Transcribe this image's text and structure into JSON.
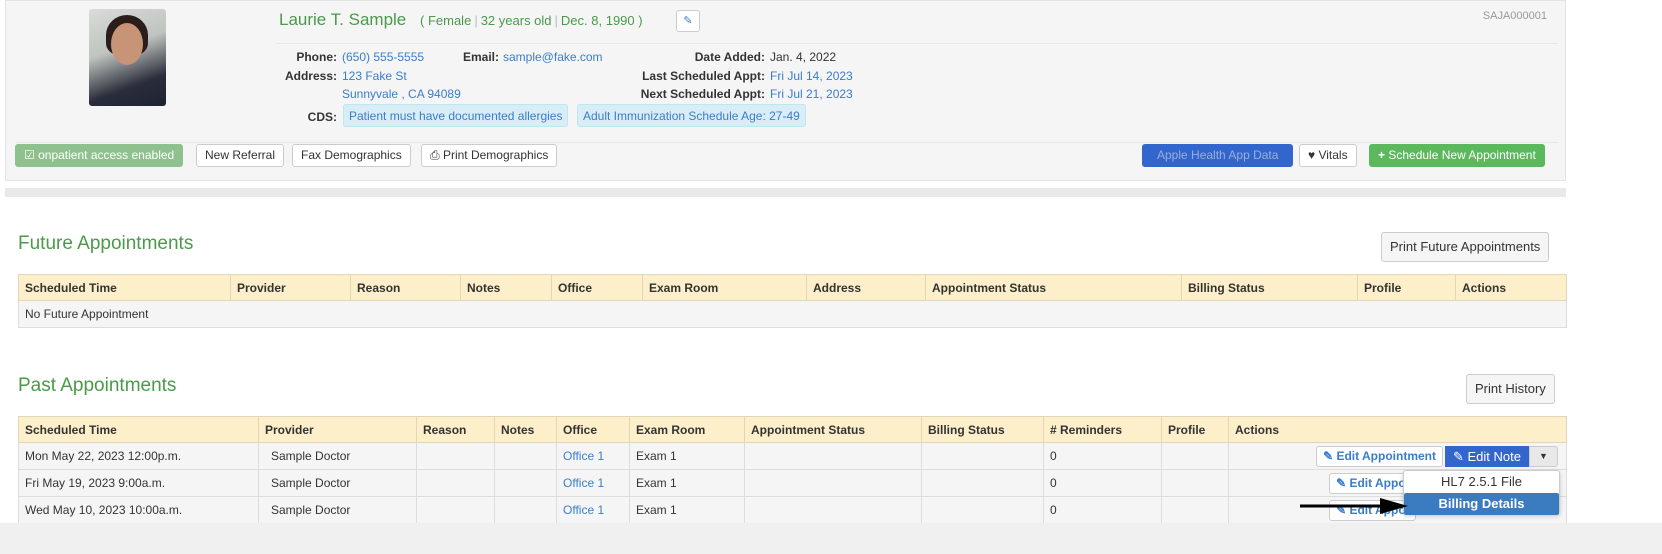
{
  "patient": {
    "name": "Laurie T. Sample",
    "gender": "Female",
    "age": "32 years old",
    "dob": "Dec. 8, 1990",
    "id": "SAJA000001",
    "phone_label": "Phone:",
    "phone": "(650) 555-5555",
    "email_label": "Email:",
    "email": "sample@fake.com",
    "address_label": "Address:",
    "address1": "123 Fake St",
    "address2": "Sunnyvale , CA 94089",
    "date_added_label": "Date Added:",
    "date_added": "Jan. 4, 2022",
    "last_appt_label": "Last Scheduled Appt:",
    "last_appt": "Fri Jul 14, 2023",
    "next_appt_label": "Next Scheduled Appt:",
    "next_appt": "Fri Jul 21, 2023",
    "cds_label": "CDS:",
    "cds": [
      "Patient must have documented allergies",
      "Adult Immunization Schedule Age: 27-49"
    ]
  },
  "toolbar": {
    "onpatient": "onpatient access enabled",
    "new_referral": "New Referral",
    "fax": "Fax Demographics",
    "print": "Print Demographics",
    "apple": "Apple Health App Data",
    "vitals": "Vitals",
    "schedule": "Schedule New Appointment"
  },
  "future": {
    "title": "Future Appointments",
    "print": "Print Future Appointments",
    "columns": [
      "Scheduled Time",
      "Provider",
      "Reason",
      "Notes",
      "Office",
      "Exam Room",
      "Address",
      "Appointment Status",
      "Billing Status",
      "Profile",
      "Actions"
    ],
    "empty": "No Future Appointment"
  },
  "past": {
    "title": "Past Appointments",
    "print": "Print History",
    "columns": [
      "Scheduled Time",
      "Provider",
      "Reason",
      "Notes",
      "Office",
      "Exam Room",
      "Appointment Status",
      "Billing Status",
      "# Reminders",
      "Profile",
      "Actions"
    ],
    "rows": [
      {
        "time": "Mon May 22, 2023 12:00p.m.",
        "provider": "Sample Doctor",
        "office": "Office 1",
        "room": "Exam 1",
        "reminders": "0"
      },
      {
        "time": "Fri May 19, 2023 9:00a.m.",
        "provider": "Sample Doctor",
        "office": "Office 1",
        "room": "Exam 1",
        "reminders": "0"
      },
      {
        "time": "Wed May 10, 2023 10:00a.m.",
        "provider": "Sample Doctor",
        "office": "Office 1",
        "room": "Exam 1",
        "reminders": "0"
      }
    ],
    "edit_appt": "Edit Appointment",
    "edit_appt_short": "Edit Appoi",
    "edit_note": "Edit Note"
  },
  "dropdown": {
    "items": [
      "HL7 2.5.1 File",
      "Billing Details"
    ]
  },
  "colors": {
    "green": "#4a9a4a",
    "link": "#3a7dc9",
    "primary": "#3366cc",
    "header": "#fcefc9"
  }
}
